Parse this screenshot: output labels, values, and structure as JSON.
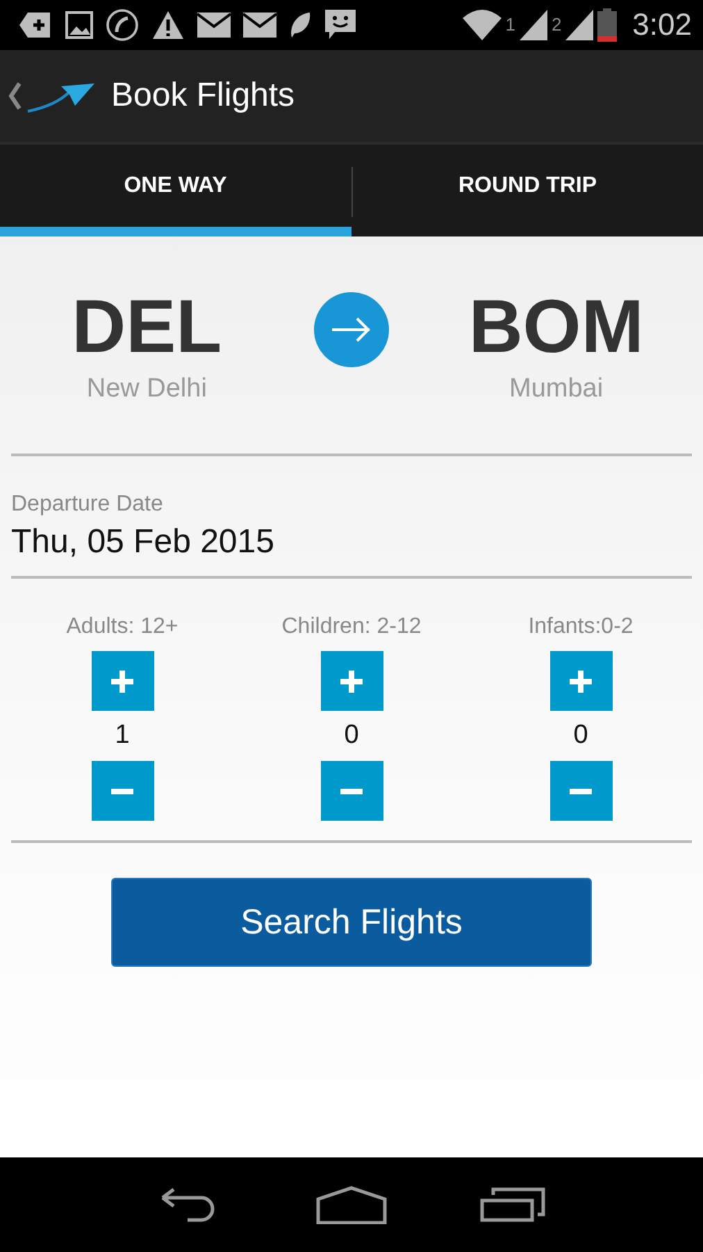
{
  "status_bar": {
    "sim_1": "1",
    "sim_2": "2",
    "time": "3:02"
  },
  "action_bar": {
    "title": "Book Flights"
  },
  "tabs": [
    {
      "label": "ONE WAY",
      "selected": true
    },
    {
      "label": "ROUND TRIP",
      "selected": false
    }
  ],
  "route": {
    "from": {
      "code": "DEL",
      "city": "New Delhi"
    },
    "to": {
      "code": "BOM",
      "city": "Mumbai"
    }
  },
  "departure": {
    "label": "Departure Date",
    "value": "Thu, 05 Feb 2015"
  },
  "passengers": [
    {
      "label": "Adults: 12+",
      "count": "1"
    },
    {
      "label": "Children: 2-12",
      "count": "0"
    },
    {
      "label": "Infants:0-2",
      "count": "0"
    }
  ],
  "search_button": "Search Flights"
}
